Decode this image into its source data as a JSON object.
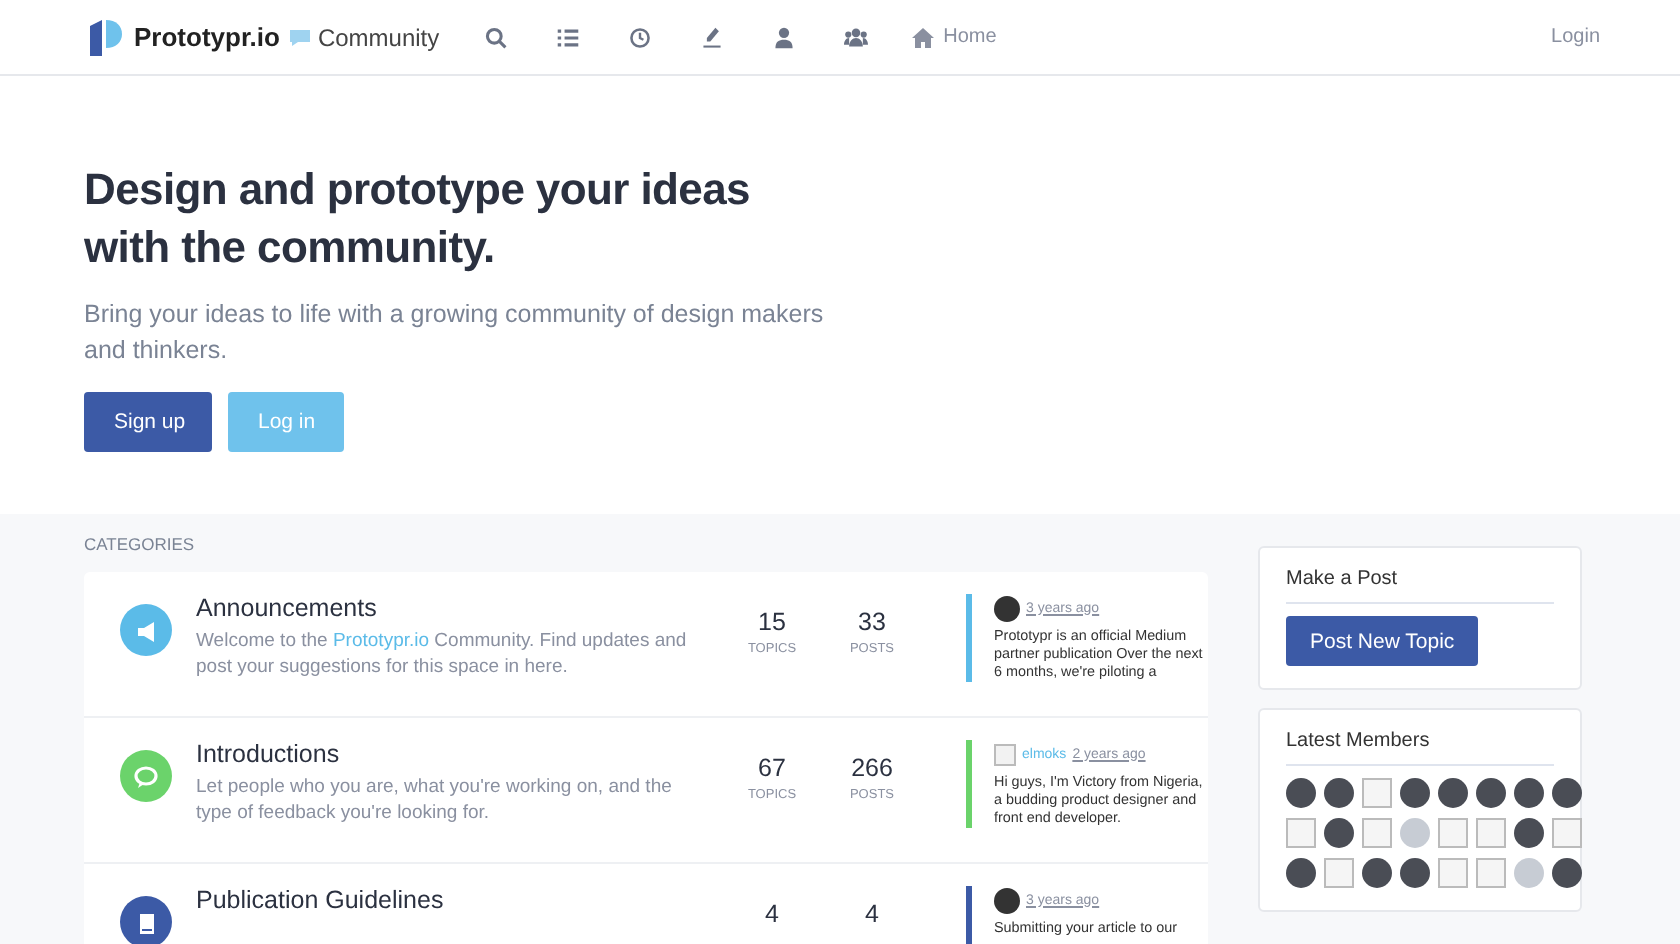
{
  "nav": {
    "brand": "Prototypr.io",
    "community": "Community",
    "icons": [
      {
        "kind": "search"
      },
      {
        "kind": "list"
      },
      {
        "kind": "clock"
      },
      {
        "kind": "pen"
      },
      {
        "kind": "user"
      },
      {
        "kind": "users"
      }
    ],
    "home": "Home",
    "login": "Login"
  },
  "hero": {
    "title": "Design and prototype your ideas with the community.",
    "subtitle": "Bring your ideas to life with a growing community of design makers and thinkers.",
    "buttons": [
      {
        "label": "Sign up",
        "kind": "primary"
      },
      {
        "label": "Log in",
        "kind": "secondary"
      }
    ]
  },
  "categories_label": "CATEGORIES",
  "categories": [
    {
      "name": "Announcements",
      "color": "#5bbbe8",
      "description": [
        {
          "kind": "text",
          "text": "Welcome to the "
        },
        {
          "kind": "link",
          "text": "Prototypr.io"
        },
        {
          "kind": "text",
          "text": " Community. Find updates and post your suggestions for this space in here."
        }
      ],
      "topics": "15",
      "topics_label": "TOPICS",
      "posts": "33",
      "posts_label": "POSTS",
      "latest": {
        "kind": "photo",
        "time": "3 years ago",
        "text": "Prototypr is an official Medium partner publication Over the next 6 months, we're piloting a"
      }
    },
    {
      "name": "Introductions",
      "color": "#6bd36b",
      "description": [
        {
          "kind": "text",
          "text": "Let people who you are, what you're working on, and the type of feedback you're looking for."
        }
      ],
      "topics": "67",
      "topics_label": "TOPICS",
      "posts": "266",
      "posts_label": "POSTS",
      "latest": {
        "kind": "broken",
        "alt": "elmoks",
        "time": "2 years ago",
        "text": "Hi guys, I'm Victory from Nigeria, a budding product designer and front end developer."
      }
    },
    {
      "name": "Publication Guidelines",
      "color": "#3c5aa6",
      "topics": "4",
      "posts": "4",
      "latest": {
        "kind": "photo",
        "time": "3 years ago",
        "text": "Submitting your article to our"
      }
    }
  ],
  "make_post": {
    "title": "Make a Post",
    "button": "Post New Topic"
  },
  "members": {
    "title": "Latest Members",
    "items": [
      {
        "kind": "photo"
      },
      {
        "kind": "photo"
      },
      {
        "kind": "broken"
      },
      {
        "kind": "photo"
      },
      {
        "kind": "photo"
      },
      {
        "kind": "photo"
      },
      {
        "kind": "photo"
      },
      {
        "kind": "photo"
      },
      {
        "kind": "broken"
      },
      {
        "kind": "photo"
      },
      {
        "kind": "broken"
      },
      {
        "kind": "silhouette"
      },
      {
        "kind": "broken"
      },
      {
        "kind": "broken"
      },
      {
        "kind": "photo"
      },
      {
        "kind": "broken"
      },
      {
        "kind": "photo"
      },
      {
        "kind": "broken"
      },
      {
        "kind": "photo"
      },
      {
        "kind": "photo"
      },
      {
        "kind": "broken"
      },
      {
        "kind": "broken"
      },
      {
        "kind": "silhouette"
      },
      {
        "kind": "photo"
      }
    ]
  }
}
